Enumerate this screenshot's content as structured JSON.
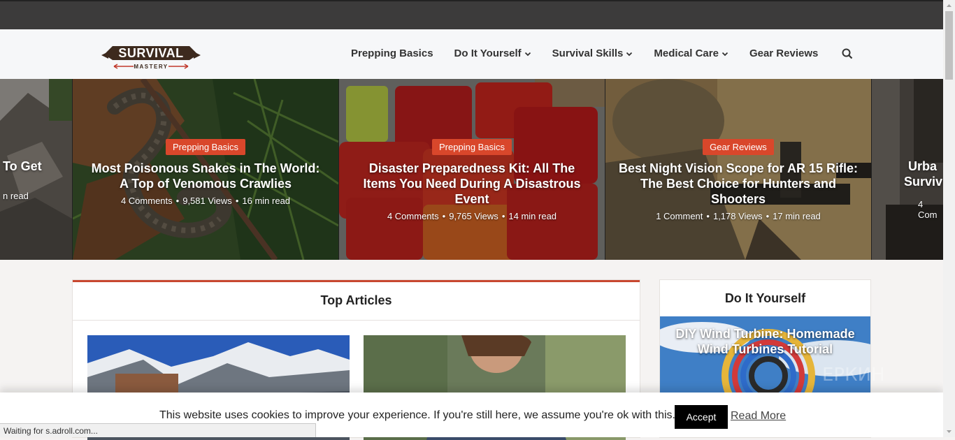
{
  "brand": {
    "logo_main": "SURVIVAL",
    "logo_sub": "MASTERY"
  },
  "nav": {
    "items": [
      {
        "label": "Prepping Basics",
        "dropdown": false
      },
      {
        "label": "Do It Yourself",
        "dropdown": true
      },
      {
        "label": "Survival Skills",
        "dropdown": true
      },
      {
        "label": "Medical Care",
        "dropdown": true
      },
      {
        "label": "Gear Reviews",
        "dropdown": false
      }
    ],
    "search_icon": "search-icon"
  },
  "slides": [
    {
      "title": "To Get",
      "meta_tail": "n read"
    },
    {
      "category": "Prepping Basics",
      "title": "Most Poisonous Snakes in The World: A Top of Venomous Crawlies",
      "comments": "4 Comments",
      "views": "9,581 Views",
      "read": "16 min read"
    },
    {
      "category": "Prepping Basics",
      "title": "Disaster Preparedness Kit: All The Items You Need During A Disastrous Event",
      "comments": "4 Comments",
      "views": "9,765 Views",
      "read": "14 min read"
    },
    {
      "category": "Gear Reviews",
      "title": "Best Night Vision Scope for AR 15 Rifle: The Best Choice for Hunters and Shooters",
      "comments": "1 Comment",
      "views": "1,178 Views",
      "read": "17 min read"
    },
    {
      "title_line1": "Urba",
      "title_line2": "Surviv",
      "meta_head": "4 Com"
    }
  ],
  "top_articles": {
    "heading": "Top Articles"
  },
  "diy_widget": {
    "heading": "Do It Yourself",
    "title": "DIY Wind Turbine: Homemade Wind Turbines Tutorial",
    "watermark": "ЕРКИН"
  },
  "cookie": {
    "message": "This website uses cookies to improve your experience. If you're still here, we assume you're ok with this.",
    "accept_label": "Accept",
    "read_more_label": "Read More"
  },
  "status_bar": {
    "text": "Waiting for s.adroll.com..."
  },
  "colors": {
    "accent": "#d9472b",
    "topbar": "#3c3b3b",
    "logo_brown": "#3d2a1e"
  }
}
